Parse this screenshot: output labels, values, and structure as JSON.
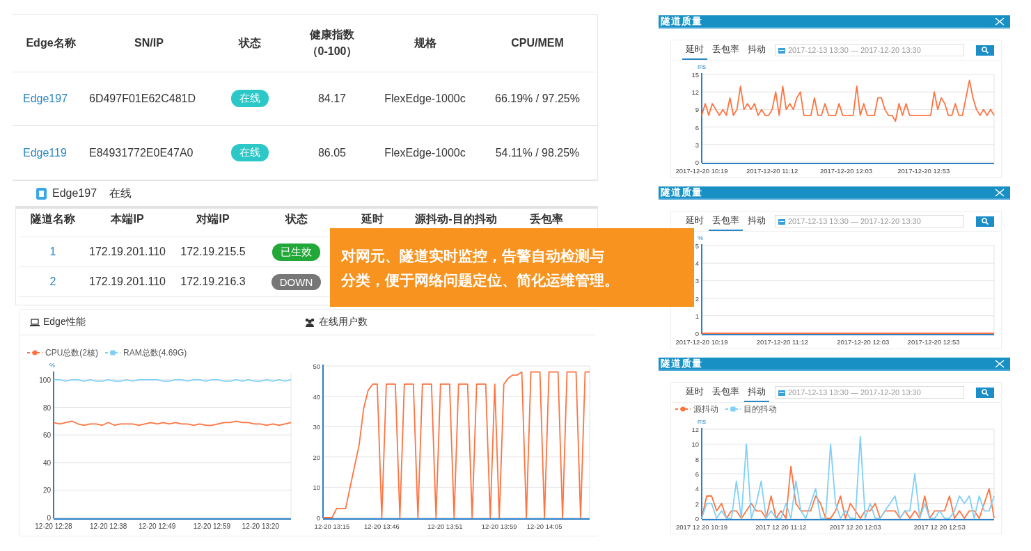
{
  "edge_table": {
    "columns": [
      {
        "label": "Edge名称"
      },
      {
        "label": "SN/IP"
      },
      {
        "label": "状态"
      },
      {
        "label": "健康指数",
        "sub": "（0-100）"
      },
      {
        "label": "规格"
      },
      {
        "label": "CPU/MEM"
      }
    ],
    "rows": [
      {
        "name": "Edge197",
        "sn": "6D497F01E62C481D",
        "status": "在线",
        "health": "84.17",
        "spec": "FlexEdge-1000c",
        "cpu_mem": "66.19% / 97.25%"
      },
      {
        "name": "Edge119",
        "sn": "E84931772E0E47A0",
        "status": "在线",
        "health": "86.05",
        "spec": "FlexEdge-1000c",
        "cpu_mem": "54.11% / 98.25%"
      }
    ]
  },
  "edge_status": {
    "name": "Edge197",
    "status": "在线"
  },
  "tunnel_table": {
    "columns": [
      "隧道名称",
      "本端IP",
      "对端IP",
      "状态",
      "延时",
      "源抖动-目的抖动",
      "丢包率"
    ],
    "rows": [
      {
        "name": "1",
        "local_ip": "172.19.201.110",
        "peer_ip": "172.19.215.5",
        "status": "已生效",
        "color": "#22a838"
      },
      {
        "name": "2",
        "local_ip": "172.19.201.110",
        "peer_ip": "172.19.216.3",
        "status": "DOWN",
        "color": "#777777"
      }
    ]
  },
  "performance": [
    {
      "title": "Edge性能",
      "kind": "laptop",
      "chart_data": {
        "type": "line",
        "grid": true,
        "ylabel": "%",
        "ylim": [
          0,
          105
        ],
        "yticks": [
          0,
          20,
          40,
          60,
          80,
          100
        ],
        "categories": [
          "12-20 12:28",
          null,
          null,
          null,
          null,
          null,
          null,
          null,
          null,
          "12-20 12:38",
          null,
          null,
          null,
          null,
          null,
          null,
          null,
          "12-20 12:49",
          null,
          null,
          null,
          null,
          null,
          null,
          null,
          null,
          "12-20 12:59",
          null,
          null,
          null,
          null,
          null,
          null,
          null,
          "12-20 13:20",
          null,
          null,
          null,
          null,
          null
        ],
        "series": [
          {
            "name": "CPU总数(2核)",
            "color": "#ff7340",
            "values": [
              69,
              68,
              69,
              70,
              68,
              67,
              68,
              68,
              67,
              69,
              67,
              68,
              68,
              68,
              67,
              68,
              69,
              68,
              69,
              68,
              69,
              68,
              68,
              67,
              68,
              67,
              67,
              68,
              69,
              69,
              70,
              69,
              69,
              68,
              68,
              67,
              68,
              67,
              68,
              69
            ]
          },
          {
            "name": "RAM总数(4.69G)",
            "color": "#7fd0f7",
            "values": [
              100,
              100,
              99,
              100,
              100,
              99,
              100,
              99,
              99,
              100,
              99,
              99,
              100,
              99,
              100,
              100,
              100,
              100,
              99,
              99,
              100,
              100,
              99,
              100,
              100,
              99,
              100,
              100,
              99,
              99,
              100,
              99,
              100,
              99,
              99,
              100,
              99,
              100,
              99,
              100
            ]
          }
        ]
      }
    },
    {
      "title": "在线用户数",
      "kind": "users",
      "chart_data": {
        "type": "line",
        "grid": true,
        "ylim": [
          0,
          50
        ],
        "yticks": [
          0,
          10,
          20,
          30,
          40,
          50
        ],
        "categories": [
          null,
          null,
          "12-20 13:15",
          null,
          null,
          null,
          null,
          null,
          null,
          null,
          null,
          null,
          null,
          "12-20 13:46",
          null,
          null,
          null,
          null,
          null,
          null,
          null,
          null,
          null,
          null,
          null,
          null,
          null,
          "12-20 13:51",
          null,
          null,
          null,
          null,
          null,
          null,
          null,
          null,
          null,
          null,
          null,
          "12-20 13:59",
          null,
          null,
          null,
          null,
          null,
          null,
          null,
          null,
          null,
          "12-20 14:05",
          null,
          null,
          null,
          null,
          null,
          null,
          null,
          null,
          null,
          null
        ],
        "series": [
          {
            "color": "#ff7340",
            "values": [
              0,
              0,
              0,
              3,
              3,
              3,
              10,
              17,
              24,
              36,
              42,
              44,
              44,
              0,
              44,
              44,
              44,
              0,
              44,
              44,
              44,
              0,
              44,
              44,
              44,
              0,
              44,
              44,
              44,
              0,
              44,
              44,
              44,
              0,
              44,
              44,
              44,
              0,
              44,
              0,
              44,
              46,
              47,
              47,
              48,
              0,
              48,
              48,
              48,
              0,
              48,
              48,
              48,
              0,
              48,
              48,
              48,
              0,
              48,
              48
            ]
          }
        ]
      }
    }
  ],
  "callout": {
    "lines": [
      "对网元、隧道实时监控，告警自动检测与",
      "分类，便于网络问题定位、简化运维管理。"
    ]
  },
  "quality_panels": [
    {
      "title": "隧道质量",
      "tabs": [
        {
          "label": "延时",
          "selected": true
        },
        {
          "label": "丢包率",
          "selected": false
        },
        {
          "label": "抖动",
          "selected": false
        }
      ],
      "date_range": "2017-12-13 13:30 — 2017-12-20 13:30",
      "chart_data": {
        "type": "line",
        "grid": true,
        "ylabel": "ms",
        "ylim": [
          0,
          15
        ],
        "yticks": [
          0,
          3,
          6,
          9,
          12,
          15
        ],
        "categories": [
          "2017-12-20 10:19",
          null,
          null,
          null,
          null,
          null,
          null,
          null,
          null,
          null,
          null,
          null,
          null,
          null,
          null,
          null,
          null,
          null,
          null,
          null,
          "2017-12-20 11:12",
          null,
          null,
          null,
          null,
          null,
          null,
          null,
          null,
          null,
          null,
          null,
          null,
          null,
          null,
          null,
          null,
          null,
          null,
          null,
          null,
          "2017-12-20 12:03",
          null,
          null,
          null,
          null,
          null,
          null,
          null,
          null,
          null,
          null,
          null,
          null,
          null,
          null,
          null,
          null,
          null,
          null,
          null,
          null,
          null,
          "2017-12-20 12:53",
          null,
          null,
          null,
          null,
          null,
          null,
          null,
          null,
          null,
          null,
          null,
          null,
          null,
          null,
          null,
          null,
          null,
          null,
          null,
          null
        ],
        "series": [
          {
            "color": "#ff7340",
            "values": [
              8,
              10,
              8,
              10,
              9,
              8,
              9,
              8,
              11,
              8,
              9,
              13,
              9,
              10,
              9,
              10,
              8,
              9,
              8,
              8,
              9,
              12,
              8,
              13,
              9,
              10,
              9,
              11,
              12,
              8,
              8,
              8,
              11,
              8,
              8,
              10,
              8,
              8,
              8,
              10,
              8,
              8,
              8,
              8,
              13,
              8,
              10,
              8,
              8,
              8,
              11,
              11,
              9,
              8,
              8,
              7,
              10,
              8,
              10,
              8,
              8,
              8,
              8,
              8,
              8,
              8,
              12,
              9,
              11,
              10,
              8,
              8,
              10,
              8,
              8,
              11,
              14,
              11,
              9,
              8,
              9,
              8,
              9,
              8
            ]
          }
        ]
      }
    },
    {
      "title": "隧道质量",
      "tabs": [
        {
          "label": "延时",
          "selected": false
        },
        {
          "label": "丢包率",
          "selected": true
        },
        {
          "label": "抖动",
          "selected": false
        }
      ],
      "date_range": "2017-12-13 13:30 — 2017-12-20 13:30",
      "chart_data": {
        "type": "line",
        "grid": true,
        "ylabel": "%",
        "ylim": [
          0,
          5
        ],
        "yticks": [
          0,
          1,
          2,
          3,
          4,
          5
        ],
        "categories": [
          "2017-12-20 10:19",
          null,
          null,
          null,
          null,
          null,
          null,
          null,
          "2017-12-20 11:12",
          null,
          null,
          null,
          null,
          null,
          null,
          null,
          "2017-12-20 12:03",
          null,
          null,
          null,
          null,
          null,
          null,
          "2017-12-20 12:53",
          null,
          null,
          null,
          null,
          null,
          null
        ],
        "series": [
          {
            "color": "#ff7340",
            "values": [
              0,
              0,
              0,
              0,
              0,
              0,
              0,
              0,
              0,
              0,
              0,
              0,
              0,
              0,
              0,
              0,
              0,
              0,
              0,
              0,
              0,
              0,
              0,
              0,
              0,
              0,
              0,
              0,
              0,
              0
            ]
          }
        ]
      }
    },
    {
      "title": "隧道质量",
      "tabs": [
        {
          "label": "延时",
          "selected": false
        },
        {
          "label": "丢包率",
          "selected": false
        },
        {
          "label": "抖动",
          "selected": true
        }
      ],
      "date_range": "2017-12-13 13:30 — 2017-12-20 13:30",
      "chart_data": {
        "type": "line",
        "grid": true,
        "ylabel": "ms",
        "ylim": [
          0,
          12
        ],
        "yticks": [
          0,
          2,
          4,
          6,
          8,
          10,
          12
        ],
        "categories": [
          "2017 12 20 10:19",
          null,
          null,
          null,
          null,
          null,
          null,
          null,
          null,
          null,
          null,
          null,
          null,
          null,
          null,
          null,
          "2017 12 20 11:12",
          null,
          null,
          null,
          null,
          null,
          null,
          null,
          null,
          null,
          null,
          null,
          null,
          null,
          null,
          "2017 12 20 12:03",
          null,
          null,
          null,
          null,
          null,
          null,
          null,
          null,
          null,
          null,
          null,
          null,
          null,
          null,
          null,
          null,
          "2017 12 20 12:53",
          null,
          null,
          null,
          null,
          null,
          null,
          null,
          null,
          null,
          null,
          null
        ],
        "series": [
          {
            "name": "源抖动",
            "color": "#ff7340",
            "values": [
              0,
              3,
              3,
              1,
              2,
              0,
              1,
              1,
              0,
              1,
              2,
              1,
              1,
              0,
              3,
              0,
              1,
              0,
              7,
              2,
              1,
              1,
              1,
              3,
              2,
              0,
              0,
              1,
              3,
              0,
              2,
              1,
              0,
              1,
              1,
              2,
              0,
              1,
              1,
              1,
              0,
              1,
              0,
              1,
              0,
              3,
              0,
              1,
              1,
              1,
              3,
              0,
              1,
              0,
              1,
              1,
              0,
              2,
              4,
              0
            ]
          },
          {
            "name": "目的抖动",
            "color": "#7fd0f7",
            "values": [
              0,
              2,
              2,
              0,
              1,
              0,
              0,
              5,
              0,
              10,
              0,
              2,
              5,
              0,
              1,
              0,
              0,
              2,
              0,
              5,
              1,
              0,
              2,
              4,
              0,
              0,
              10,
              2,
              0,
              1,
              0,
              0,
              11,
              0,
              2,
              0,
              0,
              1,
              2,
              3,
              0,
              1,
              1,
              6,
              0,
              2,
              0,
              0,
              1,
              0,
              0,
              1,
              3,
              2,
              3,
              0,
              3,
              1,
              1,
              3
            ]
          }
        ]
      }
    }
  ]
}
